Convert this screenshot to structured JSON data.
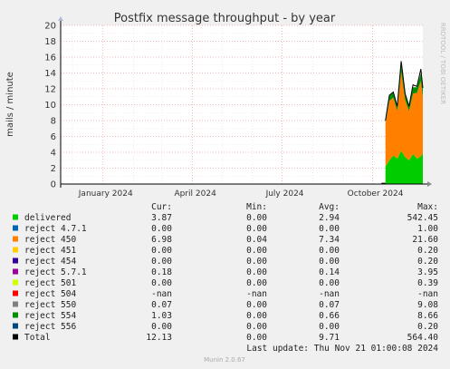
{
  "chart_data": {
    "type": "area",
    "title": "Postfix message throughput - by year",
    "ylabel": "mails / minute",
    "side_label": "RRDTOOL / TOBI OETIKER",
    "footer": "Munin 2.0.67",
    "last_update": "Last update: Thu Nov 21 01:00:08 2024",
    "ylim": [
      0,
      20
    ],
    "yticks": [
      "0",
      "2",
      "4",
      "6",
      "8",
      "10",
      "12",
      "14",
      "16",
      "18",
      "20"
    ],
    "xticks": [
      "January 2024",
      "April 2024",
      "July 2024",
      "October 2024"
    ],
    "x_range": [
      "2023-11-19",
      "2024-11-21"
    ],
    "grid": true,
    "stats_headers": [
      "Cur:",
      "Min:",
      "Avg:",
      "Max:"
    ],
    "series": [
      {
        "name": "delivered",
        "color": "#00cc00",
        "cur": "3.87",
        "min": "0.00",
        "avg": "2.94",
        "max": "542.45"
      },
      {
        "name": "reject 4.7.1",
        "color": "#0066b3",
        "cur": "0.00",
        "min": "0.00",
        "avg": "0.00",
        "max": "1.00"
      },
      {
        "name": "reject 450",
        "color": "#ff8000",
        "cur": "6.98",
        "min": "0.04",
        "avg": "7.34",
        "max": "21.60"
      },
      {
        "name": "reject 451",
        "color": "#ffcc00",
        "cur": "0.00",
        "min": "0.00",
        "avg": "0.00",
        "max": "0.20"
      },
      {
        "name": "reject 454",
        "color": "#330099",
        "cur": "0.00",
        "min": "0.00",
        "avg": "0.00",
        "max": "0.20"
      },
      {
        "name": "reject 5.7.1",
        "color": "#990099",
        "cur": "0.18",
        "min": "0.00",
        "avg": "0.14",
        "max": "3.95"
      },
      {
        "name": "reject 501",
        "color": "#ccff00",
        "cur": "0.00",
        "min": "0.00",
        "avg": "0.00",
        "max": "0.39"
      },
      {
        "name": "reject 504",
        "color": "#ff0000",
        "cur": "-nan",
        "min": "-nan",
        "avg": "-nan",
        "max": "-nan"
      },
      {
        "name": "reject 550",
        "color": "#808080",
        "cur": "0.07",
        "min": "0.00",
        "avg": "0.07",
        "max": "9.08"
      },
      {
        "name": "reject 554",
        "color": "#008f00",
        "cur": "1.03",
        "min": "0.00",
        "avg": "0.66",
        "max": "8.66"
      },
      {
        "name": "reject 556",
        "color": "#00487d",
        "cur": "0.00",
        "min": "0.00",
        "avg": "0.00",
        "max": "0.20"
      },
      {
        "name": "Total",
        "color": "#000000",
        "cur": "12.13",
        "min": "0.00",
        "avg": "9.71",
        "max": "564.40"
      }
    ],
    "activity": {
      "x": [
        "2024-10-14",
        "2024-10-18",
        "2024-10-22",
        "2024-10-26",
        "2024-10-30",
        "2024-11-03",
        "2024-11-07",
        "2024-11-11",
        "2024-11-15",
        "2024-11-19",
        "2024-11-21"
      ],
      "delivered": [
        2.2,
        3.0,
        3.6,
        3.2,
        4.2,
        3.4,
        3.0,
        3.8,
        3.2,
        3.5,
        3.9
      ],
      "reject_450": [
        5.5,
        7.5,
        7.3,
        6.0,
        10.0,
        7.2,
        6.2,
        7.6,
        8.3,
        9.5,
        7.0
      ],
      "reject_554": [
        0.4,
        0.6,
        0.7,
        0.6,
        0.9,
        0.7,
        0.6,
        0.8,
        0.7,
        1.0,
        1.0
      ],
      "total": [
        8.0,
        11.2,
        11.6,
        9.8,
        15.5,
        11.4,
        9.8,
        12.5,
        12.3,
        14.5,
        12.1
      ]
    }
  }
}
